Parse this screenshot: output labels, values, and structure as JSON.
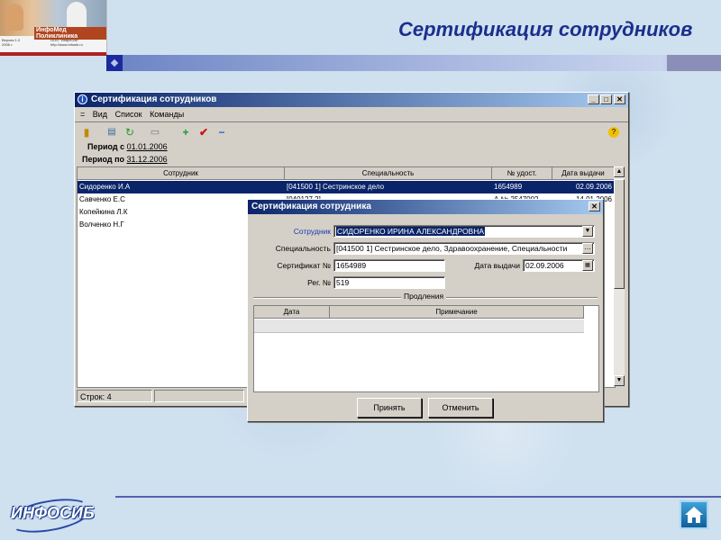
{
  "slide": {
    "title": "Сертификация сотрудников",
    "logo_brand": "ИнфоМед Поликлиника",
    "logo_small_left": "Версия 1.0\n2006 г.",
    "logo_small_right": "ООО \"ИнфоСиб\"\nhttp://www.infosib.ru",
    "footer_logo": "ИНФОСИБ",
    "colors": {
      "title": "#1a2f8c",
      "accent": "#1b2a9c"
    }
  },
  "main_window": {
    "title": "Сертификация сотрудников",
    "menu": [
      "=",
      "Вид",
      "Список",
      "Команды"
    ],
    "toolbar_icons": [
      "door-icon",
      "calc-icon",
      "refresh-icon",
      "print-icon",
      "plus-icon",
      "check-icon",
      "minus-icon",
      "help-icon"
    ],
    "period_from_label": "Период с",
    "period_from": "01.01.2006",
    "period_to_label": "Период по",
    "period_to": "31.12.2006",
    "columns": [
      "Сотрудник",
      "Специальность",
      "№ удост.",
      "Дата выдачи"
    ],
    "rows": [
      {
        "employee": "Сидоренко И.А",
        "specialty": "[041500 1] Сестринское дело",
        "cert": "1654989",
        "date": "02.09.2006",
        "selected": true
      },
      {
        "employee": "Савченко Е.С",
        "specialty": "[040127 2] ...",
        "cert": "А № 2547002",
        "date": "14.01.2006"
      },
      {
        "employee": "Копейкина Л.К",
        "specialty": "",
        "cert": "",
        "date": ""
      },
      {
        "employee": "Волченко Н.Г",
        "specialty": "",
        "cert": "",
        "date": ""
      }
    ],
    "status": "Строк: 4"
  },
  "dialog": {
    "title": "Сертификация сотрудника",
    "employee_label": "Сотрудник",
    "employee_value": "СИДОРЕНКО ИРИНА АЛЕКСАНДРОВНА",
    "specialty_label": "Специальность",
    "specialty_value": "[041500 1] Сестринское дело, Здравоохранение, Специальности",
    "cert_label": "Сертификат №",
    "cert_value": "1654989",
    "date_label": "Дата выдачи",
    "date_value": "02.09.2006",
    "reg_label": "Рег. №",
    "reg_value": "519",
    "extensions_label": "Продления",
    "ext_columns": [
      "Дата",
      "Примечание"
    ],
    "ok_label": "Принять",
    "cancel_label": "Отменить"
  }
}
